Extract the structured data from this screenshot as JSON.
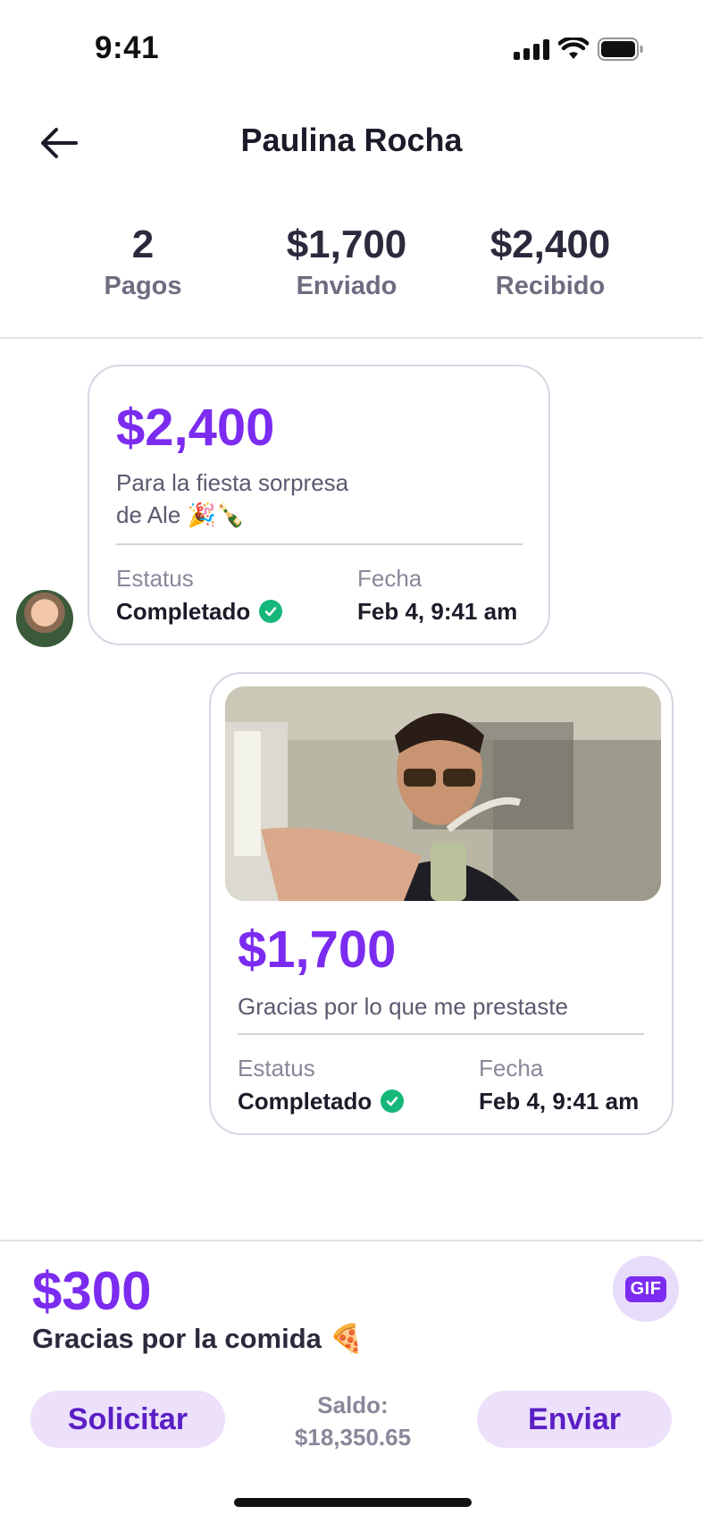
{
  "status_bar": {
    "time": "9:41"
  },
  "header": {
    "title": "Paulina Rocha"
  },
  "stats": [
    {
      "value": "2",
      "label": "Pagos"
    },
    {
      "value": "$1,700",
      "label": "Enviado"
    },
    {
      "value": "$2,400",
      "label": "Recibido"
    }
  ],
  "payments": [
    {
      "amount": "$2,400",
      "note_line1": "Para la fiesta sorpresa",
      "note_line2": "de Ale 🎉🍾",
      "status_label": "Estatus",
      "status_value": "Completado",
      "date_label": "Fecha",
      "date_value": "Feb 4, 9:41 am"
    },
    {
      "amount": "$1,700",
      "note": "Gracias por lo que me prestaste",
      "status_label": "Estatus",
      "status_value": "Completado",
      "date_label": "Fecha",
      "date_value": "Feb 4, 9:41 am"
    }
  ],
  "composer": {
    "amount": "$300",
    "note": "Gracias por la comida 🍕",
    "gif_label": "GIF"
  },
  "actions": {
    "request_label": "Solicitar",
    "send_label": "Enviar",
    "balance_label": "Saldo:",
    "balance_value": "$18,350.65"
  },
  "colors": {
    "accent": "#7b2cf0",
    "button_bg": "#ece0fb",
    "success": "#16b87a"
  }
}
